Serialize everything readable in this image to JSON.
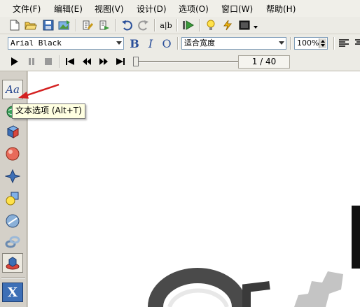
{
  "menu": {
    "items": [
      "文件(F)",
      "编辑(E)",
      "视图(V)",
      "设计(D)",
      "选项(O)",
      "窗口(W)",
      "帮助(H)"
    ]
  },
  "format_toolbar": {
    "font_name": "Arial Black",
    "bold_label": "B",
    "italic_label": "I",
    "outline_label": "O",
    "fit_mode": "适合宽度",
    "zoom": "100%"
  },
  "playback": {
    "frame_counter": "1 / 40"
  },
  "tooltip": {
    "text": "文本选项 (Alt+T)"
  },
  "left_tools": {
    "text_tool_glyph": "Aa",
    "x_tool_glyph": "X"
  },
  "colors": {
    "arrow": "#d42020",
    "toolbar_bg": "#ecebe5",
    "canvas_bg": "#ffffff"
  }
}
